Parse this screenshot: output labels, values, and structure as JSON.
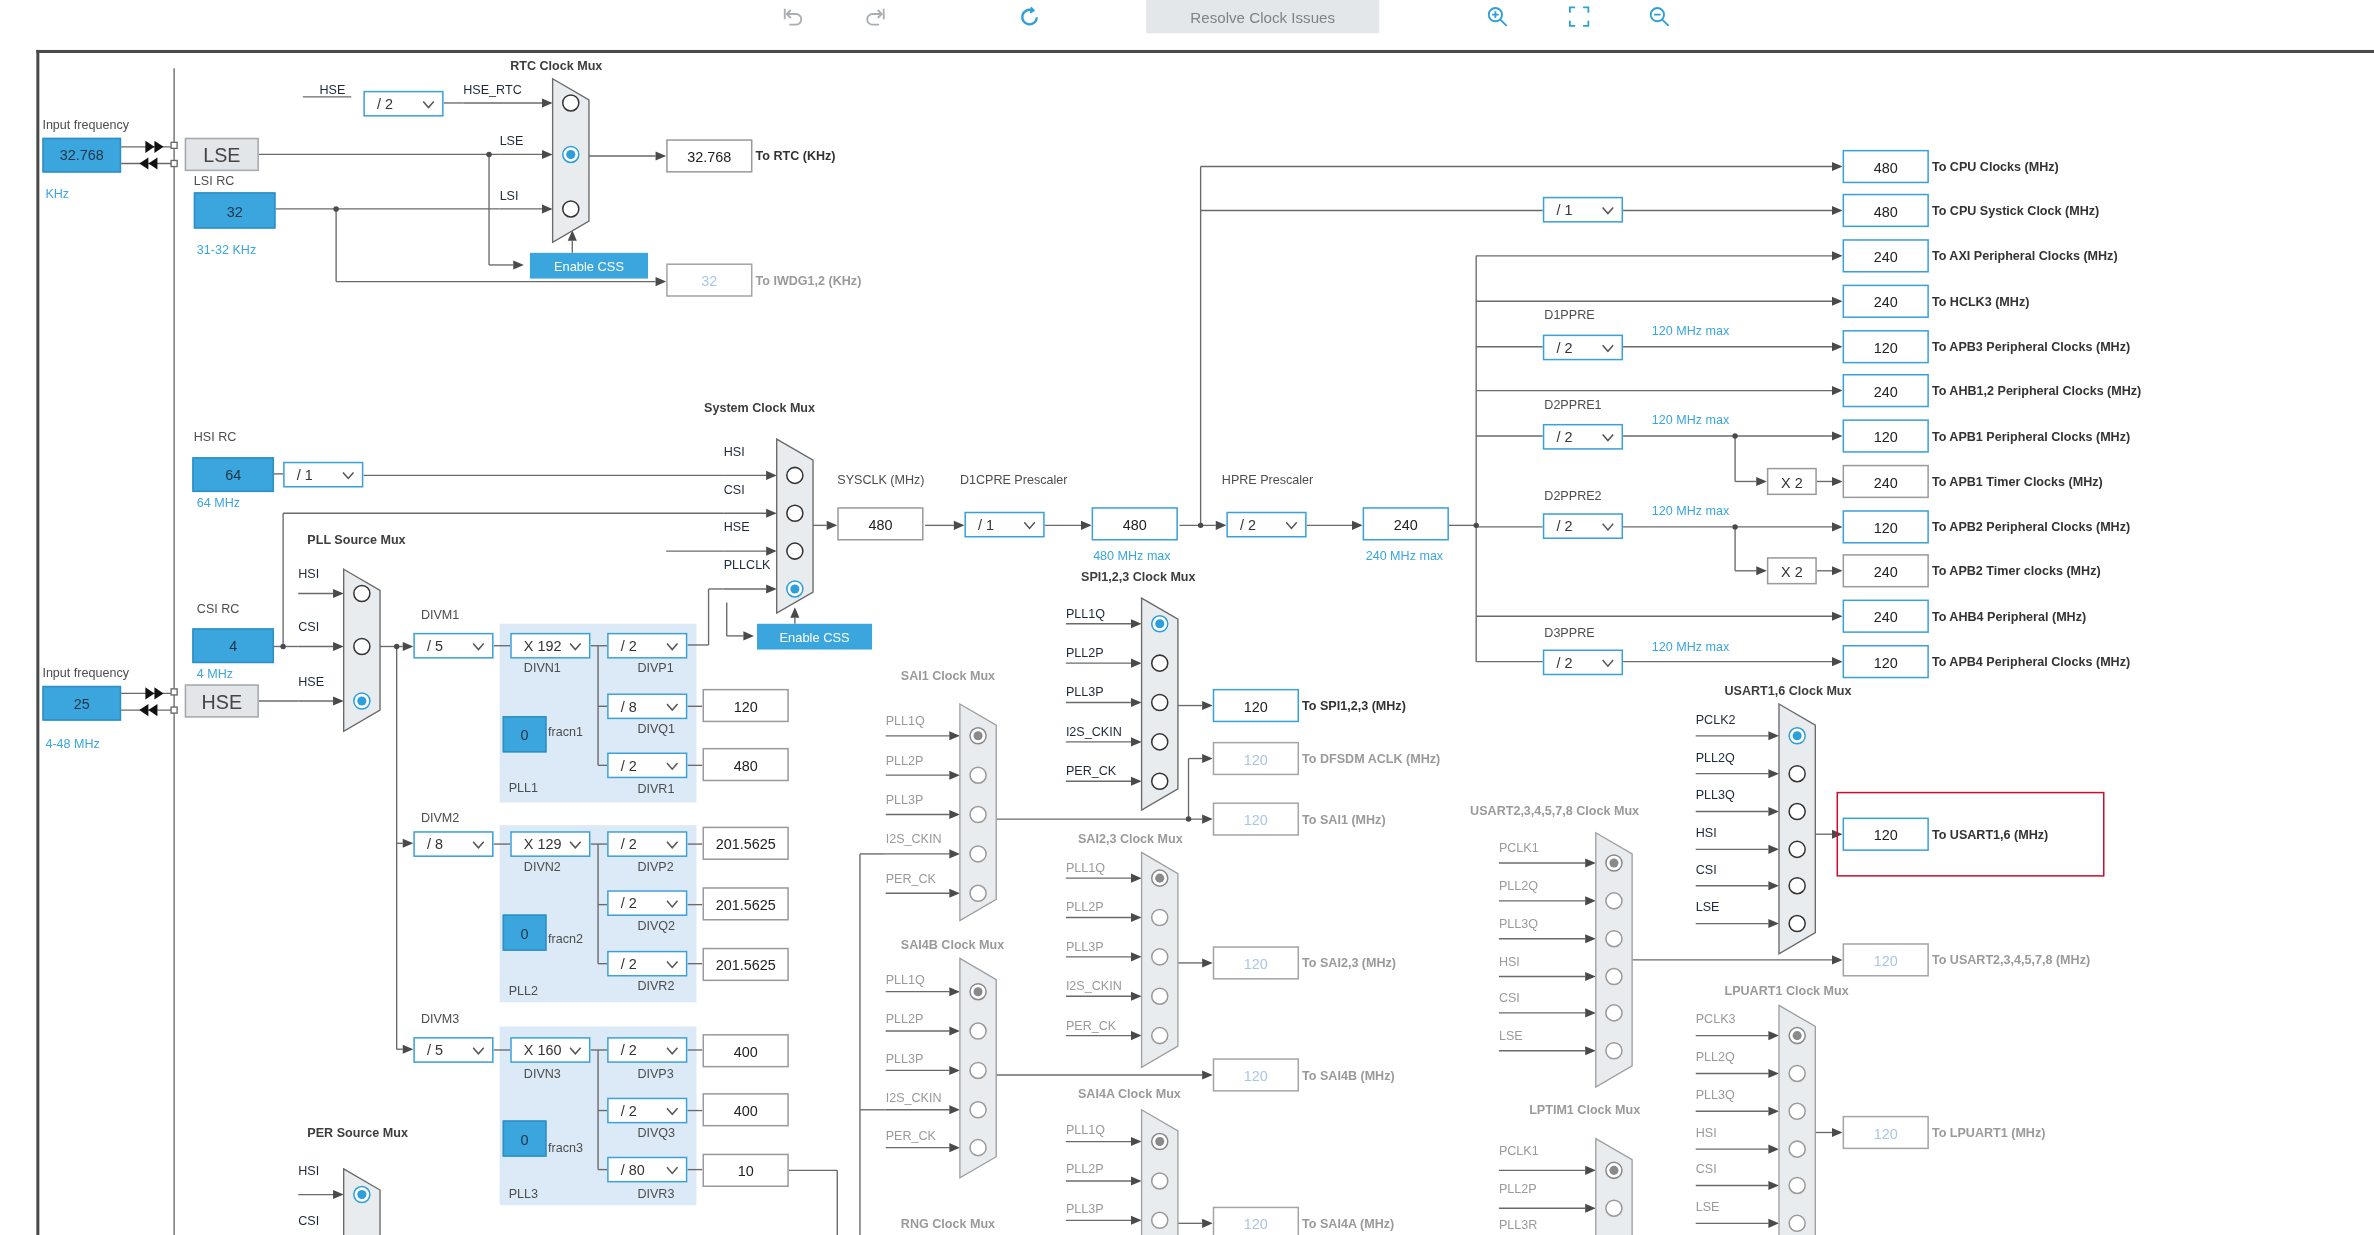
{
  "toolbar": [
    {
      "kind": "undo",
      "disabled": true
    },
    {
      "kind": "redo",
      "disabled": true
    },
    {
      "kind": "reset",
      "disabled": false
    },
    {
      "kind": "text",
      "label": "Resolve Clock Issues",
      "disabled": true
    },
    {
      "kind": "zoom_in",
      "disabled": false
    },
    {
      "kind": "fit",
      "disabled": false
    },
    {
      "kind": "zoom_out",
      "disabled": false
    }
  ],
  "labels": [
    {
      "text": "Input frequency",
      "kind": "caption"
    },
    {
      "text": "KHz",
      "kind": "hint"
    },
    {
      "text": "LSI RC",
      "kind": "caption"
    },
    {
      "text": "31-32 KHz",
      "kind": "hint"
    },
    {
      "text": "HSE",
      "kind": "signal"
    },
    {
      "text": "RTC Clock Mux",
      "kind": "title"
    },
    {
      "text": "HSI RC",
      "kind": "caption"
    },
    {
      "text": "64 MHz",
      "kind": "hint"
    },
    {
      "text": "CSI RC",
      "kind": "caption"
    },
    {
      "text": "Input frequency",
      "kind": "caption"
    },
    {
      "text": "4 MHz",
      "kind": "hint"
    },
    {
      "text": "4-48 MHz",
      "kind": "hint"
    },
    {
      "text": "PLL Source Mux",
      "kind": "title"
    },
    {
      "text": "DIVM1",
      "kind": "caption"
    },
    {
      "text": "DIVN1",
      "kind": "caption"
    },
    {
      "text": "DIVP1",
      "kind": "caption"
    },
    {
      "text": "DIVQ1",
      "kind": "caption"
    },
    {
      "text": "DIVR1",
      "kind": "caption"
    },
    {
      "text": "fracn1",
      "kind": "caption"
    },
    {
      "text": "PLL1",
      "kind": "caption"
    },
    {
      "text": "DIVM2",
      "kind": "caption"
    },
    {
      "text": "DIVN2",
      "kind": "caption"
    },
    {
      "text": "DIVP2",
      "kind": "caption"
    },
    {
      "text": "DIVQ2",
      "kind": "caption"
    },
    {
      "text": "DIVR2",
      "kind": "caption"
    },
    {
      "text": "fracn2",
      "kind": "caption"
    },
    {
      "text": "PLL2",
      "kind": "caption"
    },
    {
      "text": "DIVM3",
      "kind": "caption"
    },
    {
      "text": "DIVN3",
      "kind": "caption"
    },
    {
      "text": "DIVP3",
      "kind": "caption"
    },
    {
      "text": "DIVQ3",
      "kind": "caption"
    },
    {
      "text": "DIVR3",
      "kind": "caption"
    },
    {
      "text": "fracn3",
      "kind": "caption"
    },
    {
      "text": "PLL3",
      "kind": "caption"
    },
    {
      "text": "PER Source Mux",
      "kind": "title"
    },
    {
      "text": "System Clock Mux",
      "kind": "title"
    },
    {
      "text": "SYSCLK (MHz)",
      "kind": "caption"
    },
    {
      "text": "D1CPRE Prescaler",
      "kind": "caption"
    },
    {
      "text": "480 MHz max",
      "kind": "hint"
    },
    {
      "text": "HPRE Prescaler",
      "kind": "caption"
    },
    {
      "text": "240 MHz max",
      "kind": "hint"
    },
    {
      "text": "SPI1,2,3 Clock Mux",
      "kind": "title"
    },
    {
      "text": "SAI1 Clock Mux",
      "kind": "title_muted"
    },
    {
      "text": "SAI2,3 Clock Mux",
      "kind": "title_muted"
    },
    {
      "text": "SAI4B Clock Mux",
      "kind": "title_muted"
    },
    {
      "text": "SAI4A Clock Mux",
      "kind": "title_muted"
    },
    {
      "text": "RNG Clock Mux",
      "kind": "title_muted"
    },
    {
      "text": "D1PPRE",
      "kind": "caption"
    },
    {
      "text": "120 MHz max",
      "kind": "hint"
    },
    {
      "text": "D2PPRE1",
      "kind": "caption"
    },
    {
      "text": "120 MHz max",
      "kind": "hint"
    },
    {
      "text": "D2PPRE2",
      "kind": "caption"
    },
    {
      "text": "120 MHz max",
      "kind": "hint"
    },
    {
      "text": "D3PPRE",
      "kind": "caption"
    },
    {
      "text": "120 MHz max",
      "kind": "hint"
    },
    {
      "text": "USART1,6 Clock Mux",
      "kind": "title"
    },
    {
      "text": "USART2,3,4,5,7,8 Clock Mux",
      "kind": "title_muted"
    },
    {
      "text": "LPUART1 Clock Mux",
      "kind": "title_muted"
    },
    {
      "text": "LPTIM1 Clock Mux",
      "kind": "title_muted"
    }
  ],
  "fields": [
    {
      "value": "32.768"
    },
    {
      "value": "32"
    },
    {
      "value": "64"
    },
    {
      "value": "4"
    },
    {
      "value": "25"
    },
    {
      "value": "0"
    },
    {
      "value": "0"
    },
    {
      "value": "0"
    }
  ],
  "sources": [
    {
      "label": "LSE"
    },
    {
      "label": "HSE"
    }
  ],
  "dropdowns": [
    {
      "value": "/ 2"
    },
    {
      "value": "/ 1"
    },
    {
      "value": "/ 5"
    },
    {
      "value": "X 192"
    },
    {
      "value": "/ 2"
    },
    {
      "value": "/ 8"
    },
    {
      "value": "/ 2"
    },
    {
      "value": "/ 8"
    },
    {
      "value": "X 129"
    },
    {
      "value": "/ 2"
    },
    {
      "value": "/ 2"
    },
    {
      "value": "/ 2"
    },
    {
      "value": "/ 5"
    },
    {
      "value": "X 160"
    },
    {
      "value": "/ 2"
    },
    {
      "value": "/ 2"
    },
    {
      "value": "/ 80"
    },
    {
      "value": "/ 1"
    },
    {
      "value": "/ 2"
    },
    {
      "value": "/ 1"
    },
    {
      "value": "/ 2"
    },
    {
      "value": "/ 2"
    },
    {
      "value": "/ 2"
    },
    {
      "value": "/ 2"
    }
  ],
  "multipliers": [
    {
      "value": "X 2"
    },
    {
      "value": "X 2"
    }
  ],
  "buttons": [
    {
      "label": "Enable CSS"
    },
    {
      "label": "Enable CSS"
    }
  ],
  "muxes": [
    {
      "active": true,
      "inputs": [
        {
          "label": "HSE_RTC",
          "selected": false
        },
        {
          "label": "LSE",
          "selected": true
        },
        {
          "label": "LSI",
          "selected": false
        }
      ]
    },
    {
      "active": true,
      "inputs": [
        {
          "label": "HSI",
          "selected": false
        },
        {
          "label": "CSI",
          "selected": false
        },
        {
          "label": "HSE",
          "selected": false
        },
        {
          "label": "PLLCLK",
          "selected": true
        }
      ]
    },
    {
      "active": true,
      "inputs": [
        {
          "label": "HSI",
          "selected": false
        },
        {
          "label": "CSI",
          "selected": false
        },
        {
          "label": "HSE",
          "selected": true
        }
      ]
    },
    {
      "active": true,
      "inputs": [
        {
          "label": "HSI",
          "selected": true
        },
        {
          "label": "CSI"
        }
      ]
    },
    {
      "active": true,
      "inputs": [
        {
          "label": "PLL1Q",
          "selected": true
        },
        {
          "label": "PLL2P",
          "selected": false
        },
        {
          "label": "PLL3P",
          "selected": false
        },
        {
          "label": "I2S_CKIN",
          "selected": false
        },
        {
          "label": "PER_CK",
          "selected": false
        }
      ]
    },
    {
      "active": false,
      "inputs": [
        {
          "label": "PLL1Q",
          "selected": true
        },
        {
          "label": "PLL2P",
          "selected": false
        },
        {
          "label": "PLL3P",
          "selected": false
        },
        {
          "label": "I2S_CKIN",
          "selected": false
        },
        {
          "label": "PER_CK",
          "selected": false
        }
      ]
    },
    {
      "active": false,
      "inputs": [
        {
          "label": "PLL1Q",
          "selected": true
        },
        {
          "label": "PLL2P",
          "selected": false
        },
        {
          "label": "PLL3P",
          "selected": false
        },
        {
          "label": "I2S_CKIN",
          "selected": false
        },
        {
          "label": "PER_CK",
          "selected": false
        }
      ]
    },
    {
      "active": false,
      "inputs": [
        {
          "label": "PLL1Q",
          "selected": true
        },
        {
          "label": "PLL2P",
          "selected": false
        },
        {
          "label": "PLL3P",
          "selected": false
        },
        {
          "label": "I2S_CKIN",
          "selected": false
        },
        {
          "label": "PER_CK",
          "selected": false
        }
      ]
    },
    {
      "active": false,
      "inputs": [
        {
          "label": "PLL1Q",
          "selected": true
        },
        {
          "label": "PLL2P",
          "selected": false
        },
        {
          "label": "PLL3P",
          "selected": false
        }
      ]
    },
    {
      "active": true,
      "inputs": [
        {
          "label": "PCLK2",
          "selected": true
        },
        {
          "label": "PLL2Q",
          "selected": false
        },
        {
          "label": "PLL3Q",
          "selected": false
        },
        {
          "label": "HSI",
          "selected": false
        },
        {
          "label": "CSI",
          "selected": false
        },
        {
          "label": "LSE",
          "selected": false
        }
      ]
    },
    {
      "active": false,
      "inputs": [
        {
          "label": "PCLK1",
          "selected": true
        },
        {
          "label": "PLL2Q",
          "selected": false
        },
        {
          "label": "PLL3Q",
          "selected": false
        },
        {
          "label": "HSI",
          "selected": false
        },
        {
          "label": "CSI",
          "selected": false
        },
        {
          "label": "LSE",
          "selected": false
        }
      ]
    },
    {
      "active": false,
      "inputs": [
        {
          "label": "PCLK3",
          "selected": true
        },
        {
          "label": "PLL2Q",
          "selected": false
        },
        {
          "label": "PLL3Q",
          "selected": false
        },
        {
          "label": "HSI",
          "selected": false
        },
        {
          "label": "CSI",
          "selected": false
        },
        {
          "label": "LSE",
          "selected": false
        }
      ]
    },
    {
      "active": false,
      "inputs": [
        {
          "label": "PCLK1",
          "selected": true
        },
        {
          "label": "PLL2P",
          "selected": false
        },
        {
          "label": "PLL3R"
        }
      ]
    }
  ],
  "outputs": [
    {
      "value": "32.768",
      "label": "To RTC (KHz)",
      "kind": "plain",
      "highlighted": false
    },
    {
      "value": "32",
      "label": "To IWDG1,2 (KHz)",
      "kind": "inactive",
      "highlighted": false
    },
    {
      "value": "120",
      "kind": "plain",
      "highlighted": false
    },
    {
      "value": "480",
      "kind": "plain",
      "highlighted": false
    },
    {
      "value": "201.5625",
      "kind": "plain",
      "highlighted": false
    },
    {
      "value": "201.5625",
      "kind": "plain",
      "highlighted": false
    },
    {
      "value": "201.5625",
      "kind": "plain",
      "highlighted": false
    },
    {
      "value": "400",
      "kind": "plain",
      "highlighted": false
    },
    {
      "value": "400",
      "kind": "plain",
      "highlighted": false
    },
    {
      "value": "10",
      "kind": "plain",
      "highlighted": false
    },
    {
      "value": "480",
      "kind": "plain",
      "highlighted": false
    },
    {
      "value": "480",
      "kind": "active",
      "highlighted": false
    },
    {
      "value": "240",
      "kind": "active",
      "highlighted": false
    },
    {
      "value": "480",
      "label": "To CPU Clocks (MHz)",
      "kind": "active",
      "highlighted": false
    },
    {
      "value": "480",
      "label": "To CPU Systick Clock (MHz)",
      "kind": "active",
      "highlighted": false
    },
    {
      "value": "240",
      "label": "To AXI Peripheral Clocks (MHz)",
      "kind": "active",
      "highlighted": false
    },
    {
      "value": "240",
      "label": "To HCLK3 (MHz)",
      "kind": "active",
      "highlighted": false
    },
    {
      "value": "120",
      "label": "To APB3 Peripheral Clocks (MHz)",
      "kind": "active",
      "highlighted": false
    },
    {
      "value": "240",
      "label": "To AHB1,2 Peripheral Clocks (MHz)",
      "kind": "active",
      "highlighted": false
    },
    {
      "value": "120",
      "label": "To APB1 Peripheral Clocks (MHz)",
      "kind": "active",
      "highlighted": false
    },
    {
      "value": "240",
      "label": "To APB1 Timer Clocks (MHz)",
      "kind": "plain",
      "highlighted": false
    },
    {
      "value": "120",
      "label": "To APB2 Peripheral Clocks (MHz)",
      "kind": "active",
      "highlighted": false
    },
    {
      "value": "240",
      "label": "To APB2 Timer clocks (MHz)",
      "kind": "plain",
      "highlighted": false
    },
    {
      "value": "240",
      "label": "To AHB4 Peripheral (MHz)",
      "kind": "active",
      "highlighted": false
    },
    {
      "value": "120",
      "label": "To APB4 Peripheral Clocks (MHz)",
      "kind": "active",
      "highlighted": false
    },
    {
      "value": "120",
      "label": "To SPI1,2,3 (MHz)",
      "kind": "active",
      "highlighted": false
    },
    {
      "value": "120",
      "label": "To DFSDM ACLK (MHz)",
      "kind": "inactive",
      "highlighted": false
    },
    {
      "value": "120",
      "label": "To SAI1 (MHz)",
      "kind": "inactive",
      "highlighted": false
    },
    {
      "value": "120",
      "label": "To SAI2,3 (MHz)",
      "kind": "inactive",
      "highlighted": false
    },
    {
      "value": "120",
      "label": "To SAI4B (MHz)",
      "kind": "inactive",
      "highlighted": false
    },
    {
      "value": "120",
      "label": "To SAI4A (MHz)",
      "kind": "inactive",
      "highlighted": false
    },
    {
      "value": "120",
      "label": "To USART1,6 (MHz)",
      "kind": "active",
      "highlighted": true
    },
    {
      "value": "120",
      "label": "To USART2,3,4,5,7,8 (MHz)",
      "kind": "inactive",
      "highlighted": false
    },
    {
      "value": "120",
      "label": "To LPUART1 (MHz)",
      "kind": "inactive",
      "highlighted": false
    }
  ]
}
